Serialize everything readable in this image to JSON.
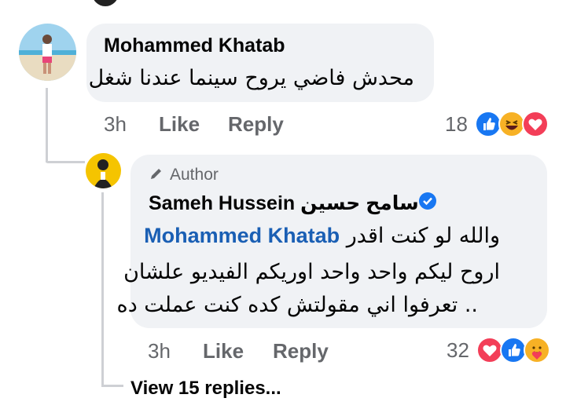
{
  "comment1": {
    "author": "Mohammed Khatab",
    "text": "محدش فاضي يروح سينما عندنا شغل",
    "time": "3h",
    "like_label": "Like",
    "reply_label": "Reply",
    "reaction_count": "18",
    "reactions": [
      "like-icon",
      "haha-icon",
      "love-icon"
    ]
  },
  "comment2": {
    "badge": "Author",
    "author": "Sameh Hussein سامح حسين",
    "mention": "Mohammed Khatab",
    "line1": "والله لو كنت اقدر",
    "line2": "اروح ليكم واحد واحد اوريكم الفيديو علشان",
    "line3": ".. تعرفوا اني مقولتش كده كنت عملت ده",
    "time": "3h",
    "like_label": "Like",
    "reply_label": "Reply",
    "reaction_count": "32",
    "reactions": [
      "love-icon",
      "like-icon",
      "care-icon"
    ]
  },
  "view_replies": "View 15 replies...",
  "colors": {
    "like": "#1877f2",
    "love": "#f33e58",
    "haha": "#f7b125",
    "verified": "#1877f2"
  }
}
